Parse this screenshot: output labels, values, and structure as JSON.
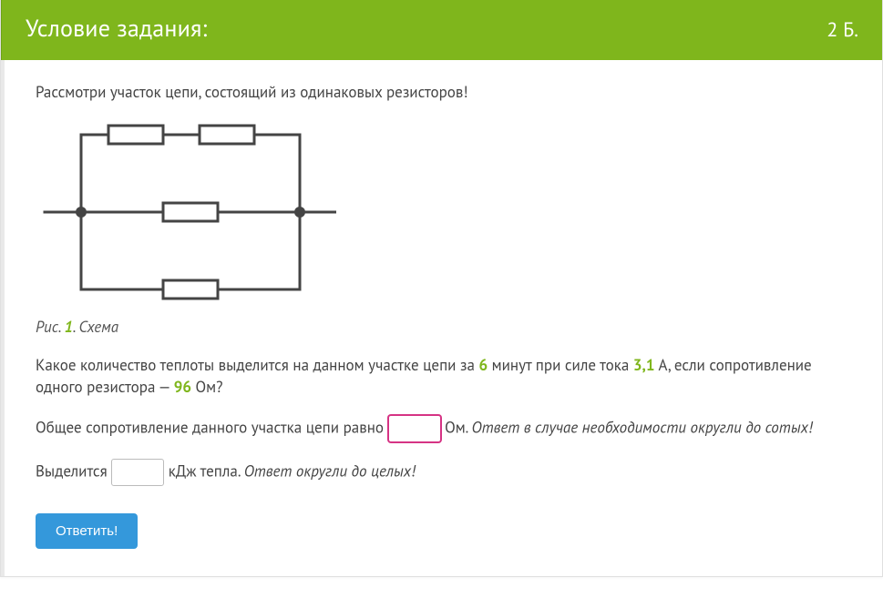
{
  "header": {
    "title": "Условие задания:",
    "points": "2 Б."
  },
  "intro": "Рассмотри участок цепи, состоящий из одинаковых резисторов!",
  "figure": {
    "label_prefix": "Рис.",
    "number": "1",
    "label_suffix": ". Схема"
  },
  "question": {
    "part1": "Какое количество теплоты выделится на данном участке цепи за ",
    "time_value": "6",
    "part2": " минут при силе тока ",
    "current_value": "3,1",
    "part3": " А, если сопротивление одного резистора — ",
    "resistance_value": "96",
    "part4": " Ом?"
  },
  "answer1": {
    "prefix": "Общее сопротивление данного участка цепи равно ",
    "unit": " Ом. ",
    "hint": "Ответ в случае необходимости округли до сотых!"
  },
  "answer2": {
    "prefix": "Выделится ",
    "unit": " кДж тепла. ",
    "hint": "Ответ округли до целых!"
  },
  "submit_label": "Ответить!"
}
